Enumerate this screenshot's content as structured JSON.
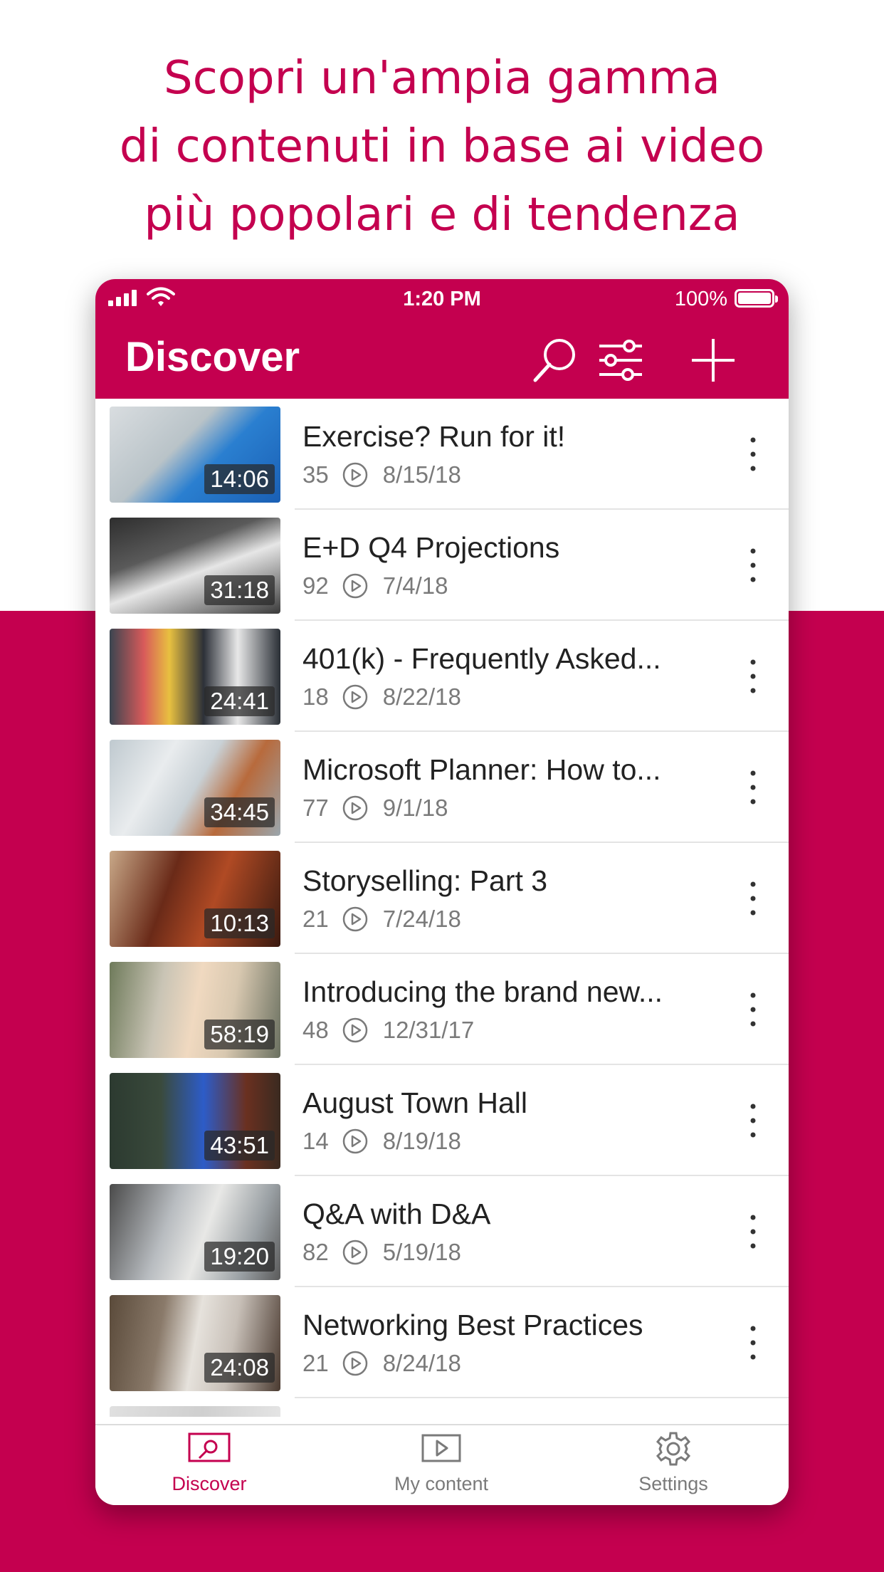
{
  "promo": {
    "line1": "Scopri un'ampia gamma",
    "line2": "di contenuti in base ai video",
    "line3": "più popolari e di tendenza"
  },
  "status_bar": {
    "time": "1:20 PM",
    "battery": "100%",
    "battery_level": 1.0
  },
  "header": {
    "title": "Discover"
  },
  "colors": {
    "accent": "#c4004f",
    "text": "#222222",
    "muted": "#7a7a7a"
  },
  "icons": [
    "search-icon",
    "filter-icon",
    "add-icon",
    "more-icon",
    "play-icon",
    "discover-icon",
    "my-content-icon",
    "settings-icon"
  ],
  "videos": [
    {
      "title": "Exercise? Run for it!",
      "views": "35",
      "date": "8/15/18",
      "duration": "14:06"
    },
    {
      "title": "E+D Q4 Projections",
      "views": "92",
      "date": "7/4/18",
      "duration": "31:18"
    },
    {
      "title": "401(k) - Frequently Asked...",
      "views": "18",
      "date": "8/22/18",
      "duration": "24:41"
    },
    {
      "title": "Microsoft Planner: How to...",
      "views": "77",
      "date": "9/1/18",
      "duration": "34:45"
    },
    {
      "title": "Storyselling: Part 3",
      "views": "21",
      "date": "7/24/18",
      "duration": "10:13"
    },
    {
      "title": "Introducing the brand new...",
      "views": "48",
      "date": "12/31/17",
      "duration": "58:19"
    },
    {
      "title": "August Town Hall",
      "views": "14",
      "date": "8/19/18",
      "duration": "43:51"
    },
    {
      "title": "Q&A with D&A",
      "views": "82",
      "date": "5/19/18",
      "duration": "19:20"
    },
    {
      "title": "Networking Best Practices",
      "views": "21",
      "date": "8/24/18",
      "duration": "24:08"
    }
  ],
  "tabs": [
    {
      "label": "Discover",
      "active": true
    },
    {
      "label": "My content",
      "active": false
    },
    {
      "label": "Settings",
      "active": false
    }
  ]
}
